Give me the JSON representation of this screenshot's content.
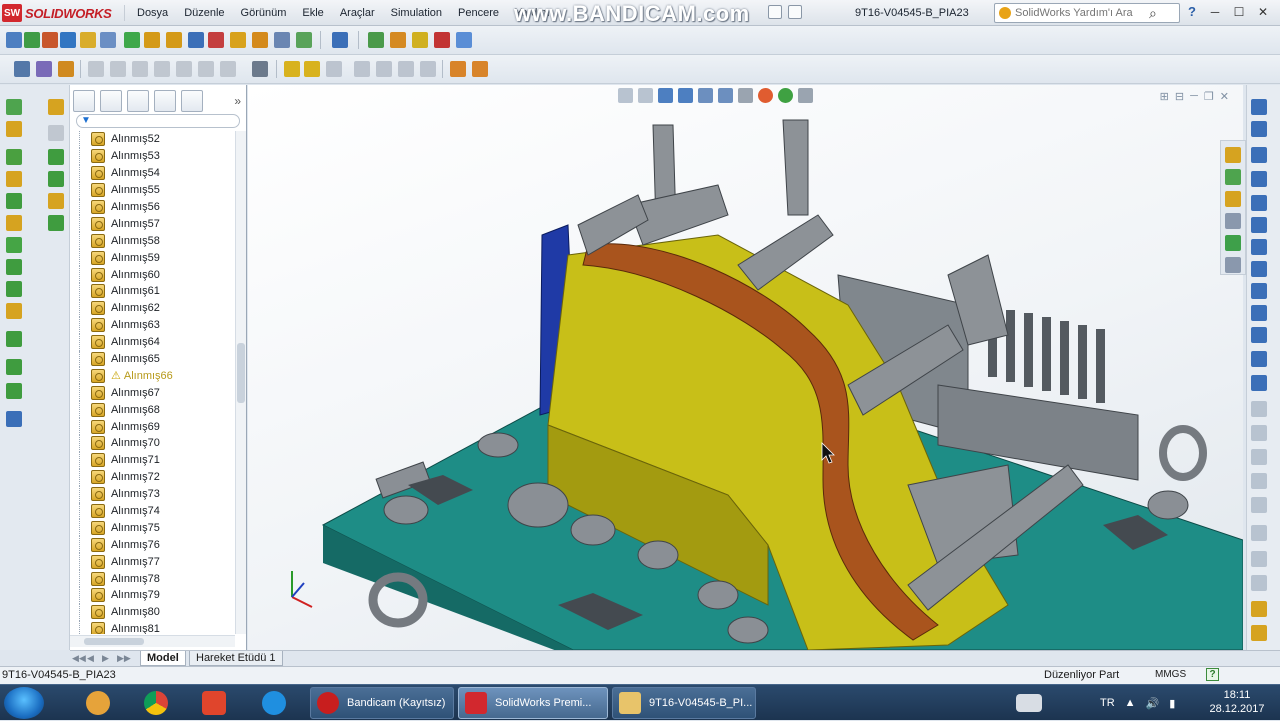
{
  "app": {
    "logo_badge": "SW",
    "logo_text": "SOLIDWORKS",
    "document_title": "9T16-V04545-B_PIA23",
    "watermark": "www.BANDICAM.com"
  },
  "menu": [
    "Dosya",
    "Düzenle",
    "Görünüm",
    "Ekle",
    "Araçlar",
    "Simulation",
    "Pencere",
    "Yardım"
  ],
  "help_search": {
    "placeholder": "SolidWorks Yardım'ı Ara"
  },
  "feature_tree": {
    "items": [
      {
        "label": "Alınmış52",
        "warning": false
      },
      {
        "label": "Alınmış53",
        "warning": false
      },
      {
        "label": "Alınmış54",
        "warning": false
      },
      {
        "label": "Alınmış55",
        "warning": false
      },
      {
        "label": "Alınmış56",
        "warning": false
      },
      {
        "label": "Alınmış57",
        "warning": false
      },
      {
        "label": "Alınmış58",
        "warning": false
      },
      {
        "label": "Alınmış59",
        "warning": false
      },
      {
        "label": "Alınmış60",
        "warning": false
      },
      {
        "label": "Alınmış61",
        "warning": false
      },
      {
        "label": "Alınmış62",
        "warning": false
      },
      {
        "label": "Alınmış63",
        "warning": false
      },
      {
        "label": "Alınmış64",
        "warning": false
      },
      {
        "label": "Alınmış65",
        "warning": false
      },
      {
        "label": "Alınmış66",
        "warning": true
      },
      {
        "label": "Alınmış67",
        "warning": false
      },
      {
        "label": "Alınmış68",
        "warning": false
      },
      {
        "label": "Alınmış69",
        "warning": false
      },
      {
        "label": "Alınmış70",
        "warning": false
      },
      {
        "label": "Alınmış71",
        "warning": false
      },
      {
        "label": "Alınmış72",
        "warning": false
      },
      {
        "label": "Alınmış73",
        "warning": false
      },
      {
        "label": "Alınmış74",
        "warning": false
      },
      {
        "label": "Alınmış75",
        "warning": false
      },
      {
        "label": "Alınmış76",
        "warning": false
      },
      {
        "label": "Alınmış77",
        "warning": false
      },
      {
        "label": "Alınmış78",
        "warning": false
      },
      {
        "label": "Alınmış79",
        "warning": false
      },
      {
        "label": "Alınmış80",
        "warning": false
      },
      {
        "label": "Alınmış81",
        "warning": false
      }
    ]
  },
  "bottom_tabs": [
    "Model",
    "Hareket Etüdü 1"
  ],
  "status": {
    "left": "9T16-V04545-B_PIA23",
    "mode": "Düzenliyor Part",
    "units": "MMGS",
    "help": "?"
  },
  "taskbar": {
    "tasks": [
      {
        "label": "Bandicam (Kayıtsız)",
        "active": false
      },
      {
        "label": "SolidWorks Premi...",
        "active": true
      },
      {
        "label": "9T16-V04545-B_PI...",
        "active": false
      }
    ],
    "language": "TR",
    "time": "18:11",
    "date": "28.12.2017"
  },
  "colors": {
    "base_plate": "#1e8d86",
    "fixture_yellow": "#c8bf18",
    "orange_part": "#a9541d",
    "blue_block": "#1f3aa6",
    "steel_grey": "#8d9297"
  }
}
